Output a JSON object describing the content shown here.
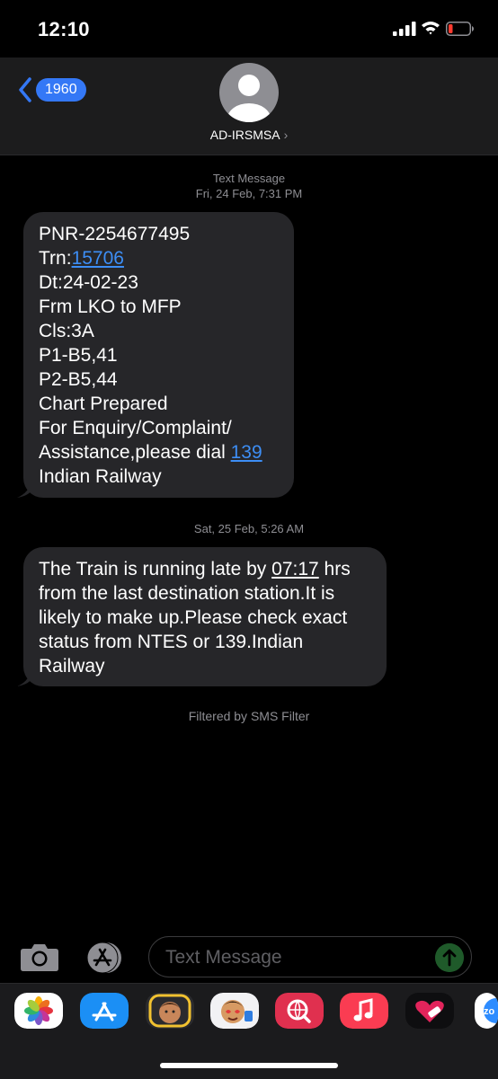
{
  "status": {
    "time": "12:10"
  },
  "header": {
    "back_count": "1960",
    "contact_name": "AD-IRSMSA",
    "chevron": "›"
  },
  "thread": {
    "meta1": {
      "line1": "Text Message",
      "line2": "Fri, 24 Feb, 7:31 PM"
    },
    "msg1": {
      "pnr": "PNR-2254677495",
      "trn_prefix": "Trn:",
      "trn_number": "15706",
      "date": "Dt:24-02-23",
      "route": "Frm LKO to MFP",
      "class": "Cls:3A",
      "p1": "P1-B5,41",
      "p2": "P2-B5,44",
      "chart": "Chart Prepared",
      "enquiry": "For Enquiry/Complaint/",
      "assist_prefix": "Assistance,please dial ",
      "assist_number": "139",
      "sign": "Indian Railway"
    },
    "meta2": "Sat, 25 Feb, 5:26 AM",
    "msg2": {
      "l1_prefix": "The Train is running late by ",
      "l1_time": "07:17",
      "l1_suffix": " hrs",
      "l2": "from the last destination station.It is",
      "l3": "likely to make up.Please check exact",
      "l4": "status from NTES or 139.Indian",
      "l5": "Railway"
    },
    "filtered": "Filtered by SMS Filter"
  },
  "composer": {
    "placeholder": "Text Message"
  },
  "dock": {
    "apps": [
      "photos-icon",
      "app-store-icon",
      "memoji-icon",
      "memoji-stickers-icon",
      "web-search-icon",
      "music-icon",
      "heart-stickers-icon",
      "zoom-icon"
    ]
  }
}
